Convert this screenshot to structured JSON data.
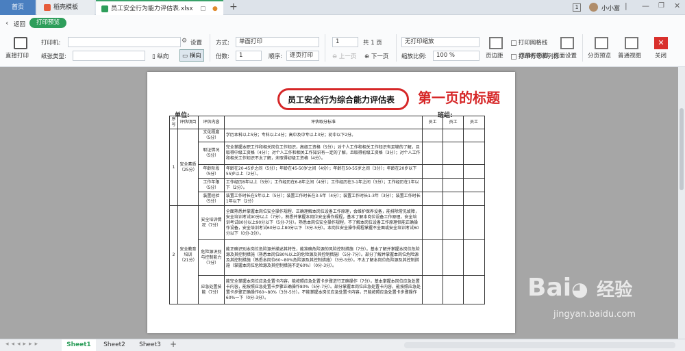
{
  "tabs": {
    "home": "首页",
    "template": "稻壳模板",
    "document": "员工安全行为能力评估表.xlsx",
    "doc_badge": "1",
    "user": "小小富"
  },
  "toolbar": {
    "back_label": "返回",
    "print_preview": "打印预览",
    "direct_print": "直接打印",
    "printer_label": "打印机:",
    "paper_type_label": "纸张类型:",
    "settings": "设置",
    "portrait": "纵向",
    "landscape": "横向",
    "mode_label": "方式:",
    "mode_value": "单面打印",
    "copies_label": "份数:",
    "copies_value": "1",
    "order_label": "顺序:",
    "order_value": "逐页打印",
    "page_value": "1",
    "total_pages": "共 1 页",
    "prev_page": "上一页",
    "next_page": "下一页",
    "scale_value": "无打印缩放",
    "print_gridlines": "打印网格线",
    "print_row_col": "打印行号和列标",
    "zoom_label": "缩放比例:",
    "zoom_value": "100 %",
    "margins": "页边距",
    "header_footer": "页眉和页脚",
    "page_setup": "页面设置",
    "page_preview": "分页预览",
    "normal_view": "普通视图",
    "close": "关闭"
  },
  "document": {
    "title": "员工安全行为综合能力评估表",
    "annotation": "第一页的标题",
    "unit_label": "单位:",
    "team_label": "班组:",
    "headers": [
      "序号",
      "评估项目",
      "评估内容",
      "评估取分标准",
      "员工",
      "员工",
      "员工"
    ],
    "groups": [
      {
        "no": "1",
        "item": "安全素质（25分）",
        "rows": [
          {
            "content": "文化程度（5分）",
            "standard": "学历本科以上5分；专科以上4分；高中及中专以上3分；初中以下2分。"
          },
          {
            "content": "取证情况（5分）",
            "standard": "完全掌握本职工作和相关岗位工作知识，高级工资格（5分）；对个人工作和相关工作知识有足够的了解，且取得中级工资格（4分）；对个人工作和相关工作知识有一定的了解，且取得初级工资格（3分）；对个人工作和相关工作知识不太了解，未取得初级工资格（4分）。"
          },
          {
            "content": "年龄阶段（5分）",
            "standard": "年龄在20-45岁之间（5分）；年龄在45-50岁之间（4分）；年龄在50-55岁之间（3分）；年龄在20岁以下55岁以上（2分）。"
          },
          {
            "content": "工作年限（5分）",
            "standard": "工作经历8年以上（5分）；工作经历在6-8年之间（4分）；工作经历在3-1年之间（3分）；工作经历在1年以下（2分）。"
          },
          {
            "content": "装置经验（5分）",
            "standard": "装置工作时长在5年以上（5分）；装置工作时长在3-5年（4分）；装置工作时长1-3年（3分）；装置工作时长1年以下（2分）"
          }
        ]
      },
      {
        "no": "2",
        "item": "安全教育培训（21分）",
        "rows": [
          {
            "content": "安全培训情况（7分）",
            "standard": "全面熟悉并掌握本岗位安全操作规程、正确理解本岗位设备工作原理，会维护保养设备，能排除常见故障，安全培训考试90分以上（7分）。熟悉并掌握本岗位安全操作规程，基本了解本岗位设备工作原理，安全培训考试80分以上90分以下（5分-7分）。熟悉本岗位安全操作规程，不了解本岗位设备工作原理但能正确操作设备，安全培训考试60分以上80分以下（3分-5分）。本岗位安全操作规程掌握不全面或安全培训考试60分以下（0分-3分）。"
          },
          {
            "content": "危险源识别与控制能力（7分）",
            "standard": "能正确识别本岗位危险源并描述其特性，能准确危险源的风险控制措施（7分）。基本了解并掌握本岗位危险源及其控制措施（熟悉本岗位80%以上的危险源及其控制措施）（5分-7分）。部分了解并掌握本岗位危险源及其控制措施（熟悉本岗位60~80%危险源及其控制措施）（3分-5分）。不太了解本岗位危险源及其控制措施（掌握本岗位危险源及其控制措施不足60%）（0分-3分）。"
          },
          {
            "content": "应急处置技能（7分）",
            "standard": "能完全掌握本岗位应急处置卡内容，能按照应急处置卡步骤进行正确操作（7分）。基本掌握本岗位应急处置卡内容，能按照应急处置卡步骤正确操作80%（5分-7分）。部分掌握本岗位应急处置卡内容，能按照应急处置卡步骤正确操作60~80%（3分-5分）。不能掌握本岗位应急处置卡内容，只能按照应急处置卡步骤操作60%一下（0分-3分）。"
          }
        ]
      }
    ]
  },
  "sheets": [
    "Sheet1",
    "Sheet2",
    "Sheet3"
  ],
  "watermark": {
    "brand": "Bai",
    "brand2": "经验",
    "url": "jingyan.baidu.com"
  }
}
